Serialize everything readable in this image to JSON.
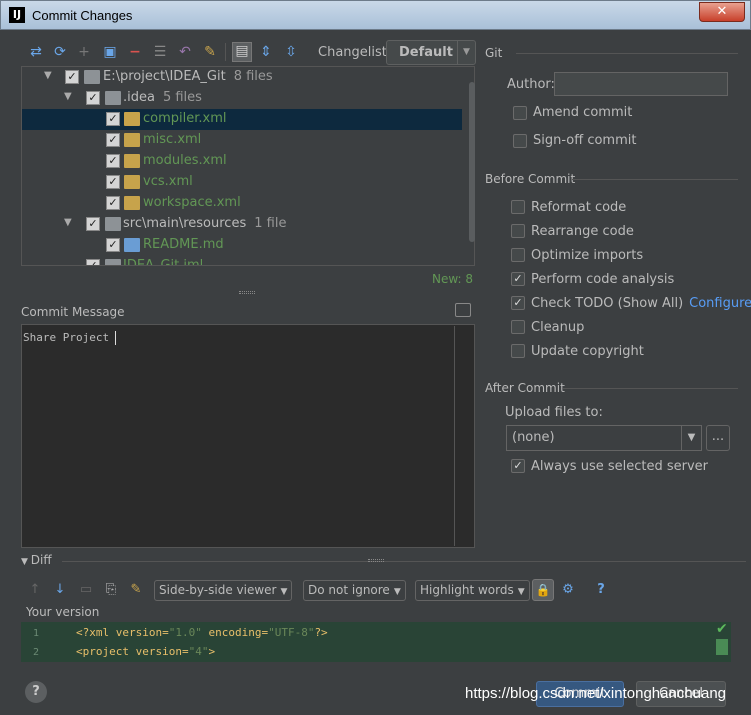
{
  "window": {
    "title": "Commit Changes",
    "close_label": "✕",
    "app_icon_label": "IJ"
  },
  "toolbar": {
    "changelist_label": "Changelist:",
    "changelist_value": "Default"
  },
  "tree": {
    "rows": [
      {
        "label": "E:\\project\\IDEA_Git",
        "count": "8 files"
      },
      {
        "label": ".idea",
        "count": "5 files"
      },
      {
        "label": "compiler.xml"
      },
      {
        "label": "misc.xml"
      },
      {
        "label": "modules.xml"
      },
      {
        "label": "vcs.xml"
      },
      {
        "label": "workspace.xml"
      },
      {
        "label": "src\\main\\resources",
        "count": "1 file"
      },
      {
        "label": "README.md"
      },
      {
        "label": "IDEA_Git.iml"
      }
    ],
    "new_count": "New: 8"
  },
  "commit_message": {
    "label": "Commit Message",
    "text": "Share Project"
  },
  "git": {
    "title": "Git",
    "author_label": "Author:",
    "author_value": "",
    "amend_label": "Amend commit",
    "signoff_label": "Sign-off commit"
  },
  "before_commit": {
    "title": "Before Commit",
    "reformat": "Reformat code",
    "rearrange": "Rearrange code",
    "optimize": "Optimize imports",
    "analysis": "Perform code analysis",
    "todo": "Check TODO (Show All)",
    "configure": "Configure",
    "cleanup": "Cleanup",
    "copyright": "Update copyright"
  },
  "after_commit": {
    "title": "After Commit",
    "upload_label": "Upload files to:",
    "upload_value": "(none)",
    "dots": "...",
    "always_label": "Always use selected server"
  },
  "diff": {
    "title": "Diff",
    "viewer": "Side-by-side viewer",
    "ignore": "Do not ignore",
    "highlight": "Highlight words",
    "your_version": "Your version",
    "line1_no": "1",
    "line2_no": "2",
    "line1_a": "<?xml version=",
    "line1_b": "\"1.0\"",
    "line1_c": " encoding=",
    "line1_d": "\"UTF-8\"",
    "line1_e": "?>",
    "line2_a": "<project version=",
    "line2_b": "\"4\"",
    "line2_c": ">"
  },
  "footer": {
    "help": "?",
    "commit": "Commit",
    "cancel": "Cancel",
    "watermark": "https://blog.csdn.net/xintonghanchuang"
  },
  "colors": {
    "accent_green": "#629755",
    "link": "#589df6",
    "selection": "#0d293e"
  }
}
